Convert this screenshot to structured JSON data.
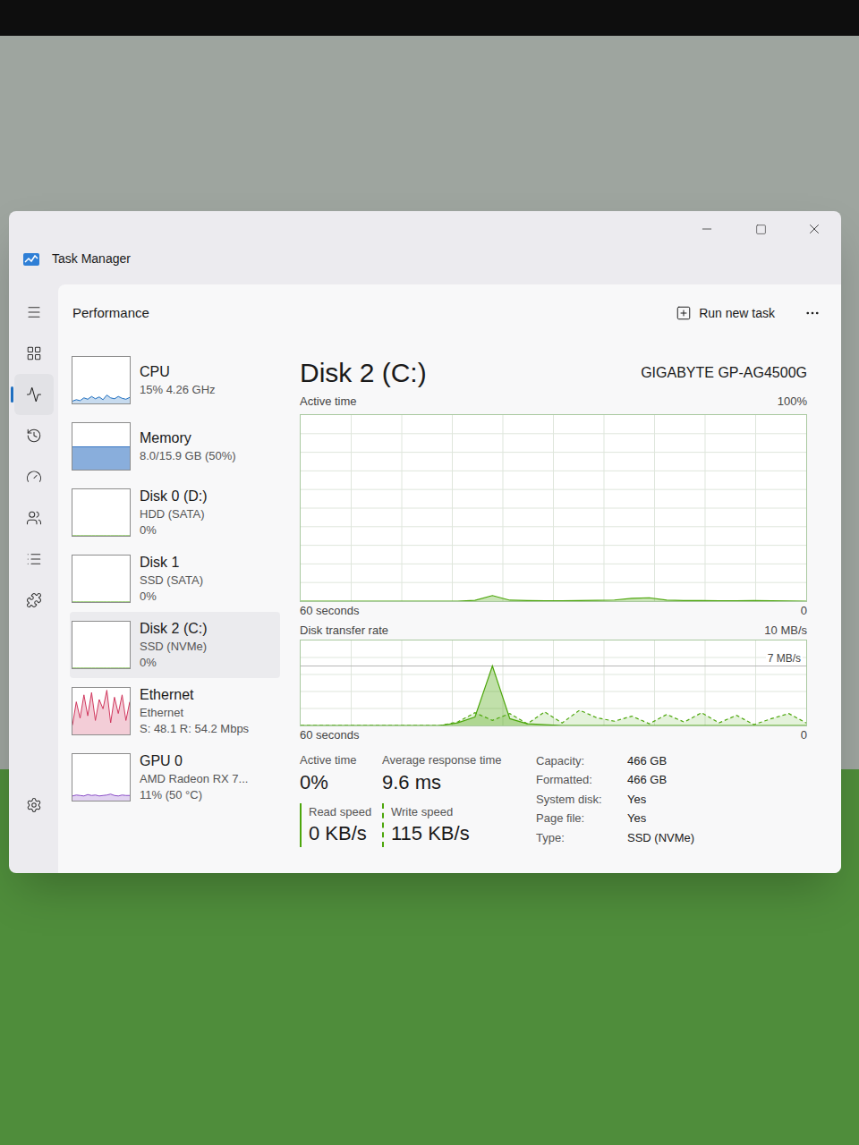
{
  "window": {
    "title": "Task Manager",
    "page": "Performance",
    "run_task": "Run new task"
  },
  "nav": [
    {
      "selected": false
    },
    {
      "selected": false
    },
    {
      "selected": true
    },
    {
      "selected": false
    },
    {
      "selected": false
    },
    {
      "selected": false
    },
    {
      "selected": false
    },
    {
      "selected": false
    },
    {
      "selected": false
    }
  ],
  "devices": [
    {
      "name": "CPU",
      "lines": [
        "15% 4.26 GHz"
      ],
      "selected": false,
      "kind": "line",
      "color": "#1f6fc0",
      "values": [
        5,
        8,
        6,
        12,
        9,
        15,
        10,
        14,
        8,
        18,
        12,
        10,
        15,
        11,
        9,
        13
      ]
    },
    {
      "name": "Memory",
      "lines": [
        "8.0/15.9 GB (50%)"
      ],
      "selected": false,
      "kind": "fill",
      "color": "#3b78c4",
      "level": 0.5
    },
    {
      "name": "Disk 0 (D:)",
      "lines": [
        "HDD (SATA)",
        "0%"
      ],
      "selected": false,
      "kind": "line",
      "color": "#4da60c",
      "values": [
        0,
        0,
        0,
        0,
        0,
        0,
        0,
        0,
        0,
        0,
        0,
        0,
        0,
        0,
        0,
        0
      ]
    },
    {
      "name": "Disk 1",
      "lines": [
        "SSD (SATA)",
        "0%"
      ],
      "selected": false,
      "kind": "line",
      "color": "#4da60c",
      "values": [
        0,
        0,
        0,
        0,
        0,
        0,
        0,
        0,
        0,
        0,
        0,
        0,
        0,
        0,
        0,
        0
      ]
    },
    {
      "name": "Disk 2 (C:)",
      "lines": [
        "SSD (NVMe)",
        "0%"
      ],
      "selected": true,
      "kind": "line",
      "color": "#4da60c",
      "values": [
        0,
        0,
        0,
        0,
        0,
        0,
        0,
        0,
        0,
        0,
        0,
        0,
        0,
        0,
        0,
        0
      ]
    },
    {
      "name": "Ethernet",
      "lines": [
        "Ethernet",
        "S: 48.1 R: 54.2 Mbps"
      ],
      "selected": false,
      "kind": "line",
      "color": "#d0385e",
      "values": [
        20,
        70,
        35,
        85,
        40,
        90,
        30,
        75,
        55,
        95,
        25,
        80,
        45,
        85,
        30,
        70
      ]
    },
    {
      "name": "GPU 0",
      "lines": [
        "AMD Radeon RX 7...",
        "11% (50 °C)"
      ],
      "selected": false,
      "kind": "line",
      "color": "#8a4fc7",
      "values": [
        10,
        12,
        11,
        10,
        13,
        11,
        12,
        10,
        11,
        12,
        14,
        11,
        10,
        12,
        11,
        11
      ]
    }
  ],
  "disk": {
    "title": "Disk 2 (C:)",
    "model": "GIGABYTE GP-AG4500G",
    "active_chart": {
      "label": "Active time",
      "max": "100%",
      "span": "60 seconds",
      "min": "0",
      "max_value": 100,
      "values": [
        0,
        0,
        0,
        0,
        0,
        0,
        0,
        0,
        0,
        0,
        0.4,
        3,
        0.5,
        0.3,
        0.2,
        0.2,
        0.3,
        0.4,
        0.6,
        1.5,
        1.8,
        0.5,
        0.3,
        0.3,
        0.2,
        0.2,
        0.3,
        0.2,
        0.1,
        0
      ]
    },
    "transfer_chart": {
      "label": "Disk transfer rate",
      "max": "10 MB/s",
      "marker": "7 MB/s",
      "marker_value": 7,
      "span": "60 seconds",
      "min": "0",
      "max_value": 10,
      "series": [
        {
          "kind": "solid",
          "values": [
            0,
            0,
            0,
            0,
            0,
            0,
            0,
            0,
            0,
            0.3,
            1,
            7,
            0.8,
            0.2,
            0.1,
            0,
            0,
            0,
            0,
            0,
            0,
            0,
            0,
            0,
            0,
            0,
            0,
            0,
            0,
            0
          ]
        },
        {
          "kind": "dashed",
          "values": [
            0,
            0,
            0,
            0,
            0,
            0,
            0,
            0,
            0,
            0.4,
            1.5,
            0.6,
            1.4,
            0.2,
            1.6,
            0.3,
            1.8,
            0.9,
            0.5,
            1.1,
            0.2,
            1.3,
            0.4,
            1.5,
            0.3,
            1.2,
            0.1,
            0.8,
            1.4,
            0.3
          ]
        }
      ]
    },
    "stats": [
      {
        "label": "Active time",
        "value": "0%"
      },
      {
        "label": "Average response time",
        "value": "9.6 ms"
      }
    ],
    "speeds": [
      {
        "label": "Read speed",
        "value": "0 KB/s",
        "kind": "solid"
      },
      {
        "label": "Write speed",
        "value": "115 KB/s",
        "kind": "dashed"
      }
    ],
    "properties": [
      {
        "label": "Capacity:",
        "value": "466 GB"
      },
      {
        "label": "Formatted:",
        "value": "466 GB"
      },
      {
        "label": "System disk:",
        "value": "Yes"
      },
      {
        "label": "Page file:",
        "value": "Yes"
      },
      {
        "label": "Type:",
        "value": "SSD (NVMe)"
      }
    ]
  }
}
